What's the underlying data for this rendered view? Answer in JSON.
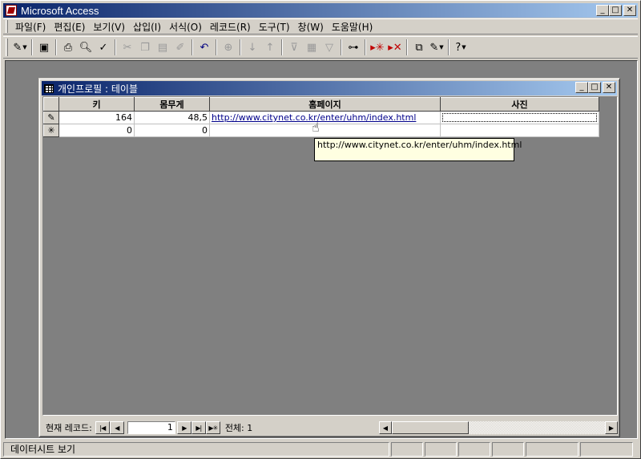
{
  "app": {
    "title": "Microsoft Access"
  },
  "menu": [
    "파일(F)",
    "편집(E)",
    "보기(V)",
    "삽입(I)",
    "서식(O)",
    "레코드(R)",
    "도구(T)",
    "창(W)",
    "도움말(H)"
  ],
  "toolbar": {
    "icons": [
      "view-design-icon",
      "save-icon",
      "print-icon",
      "print-preview-icon",
      "spelling-icon",
      "cut-icon",
      "copy-icon",
      "paste-icon",
      "format-painter-icon",
      "undo-icon",
      "insert-hyperlink-icon",
      "sort-ascending-icon",
      "sort-descending-icon",
      "filter-by-selection-icon",
      "filter-by-form-icon",
      "apply-filter-icon",
      "find-icon",
      "new-record-icon",
      "delete-record-icon",
      "database-window-icon",
      "new-object-icon",
      "help-icon"
    ]
  },
  "child_window": {
    "title": "개인프로필 : 테이블"
  },
  "table": {
    "columns": [
      "키",
      "몸무게",
      "홈페이지",
      "사진"
    ],
    "rows": [
      {
        "selector": "✎",
        "key": "164",
        "weight": "48,5",
        "homepage": "http://www.citynet.co.kr/enter/uhm/index.html",
        "photo": ""
      },
      {
        "selector": "✳",
        "key": "0",
        "weight": "0",
        "homepage": "",
        "photo": ""
      }
    ]
  },
  "tooltip": {
    "text": "http://www.citynet.co.kr/enter/uhm/index.html"
  },
  "navigation": {
    "label": "현재 레코드:",
    "current": "1",
    "total_label": "전체: 1"
  },
  "status": {
    "text": "데이터시트 보기"
  }
}
